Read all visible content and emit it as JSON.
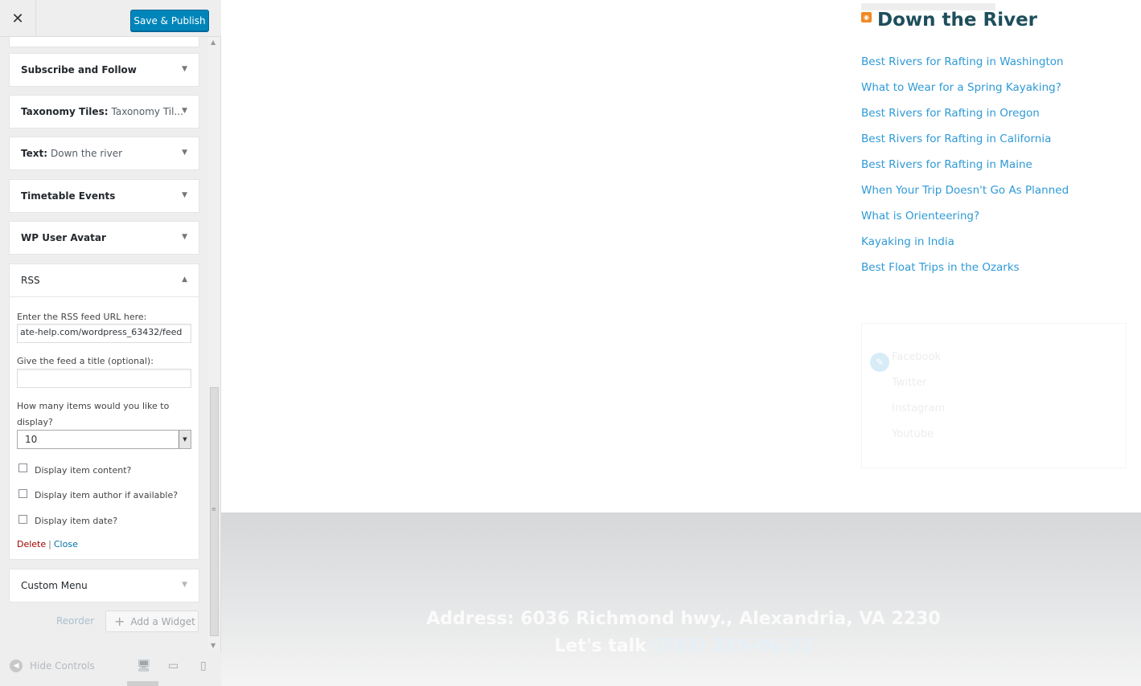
{
  "header": {
    "close_glyph": "✕",
    "publish_label": "Save & Publish"
  },
  "widgets": [
    {
      "title": "Subscribe and Follow",
      "subtitle": ""
    },
    {
      "title": "Taxonomy Tiles:",
      "subtitle": "Taxonomy Til..."
    },
    {
      "title": "Text:",
      "subtitle": "Down the river"
    },
    {
      "title": "Timetable Events",
      "subtitle": ""
    },
    {
      "title": "WP User Avatar",
      "subtitle": ""
    },
    {
      "title": "RSS",
      "subtitle": ""
    },
    {
      "title": "Custom Menu",
      "subtitle": ""
    }
  ],
  "rss_form": {
    "url_label": "Enter the RSS feed URL here:",
    "url_value": "ate-help.com/wordpress_63432/feed",
    "title_label": "Give the feed a title (optional):",
    "title_value": "",
    "count_label": "How many items would you like to display?",
    "count_value": "10",
    "checkboxes": [
      {
        "label": "Display item content?",
        "checked": false
      },
      {
        "label": "Display item author if available?",
        "checked": false
      },
      {
        "label": "Display item date?",
        "checked": false
      }
    ],
    "delete_label": "Delete",
    "separator": "|",
    "close_label": "Close"
  },
  "actions": {
    "reorder_label": "Reorder",
    "add_widget_label": "Add a Widget"
  },
  "bottom_bar": {
    "hide_controls_label": "Hide Controls"
  },
  "preview": {
    "rss_title": "Down the River",
    "rss_items": [
      "Best Rivers for Rafting in Washington",
      "What to Wear for a Spring Kayaking?",
      "Best Rivers for Rafting in Oregon",
      "Best Rivers for Rafting in California",
      "Best Rivers for Rafting in Maine",
      "When Your Trip Doesn't Go As Planned",
      "What is Orienteering?",
      "Kayaking in India",
      "Best Float Trips in the Ozarks"
    ],
    "social_links": [
      "Facebook",
      "Twitter",
      "Instagram",
      "Youtube"
    ],
    "footer_address": "Address: 6036 Richmond hwy., Alexandria, VA 2230",
    "footer_talk_prefix": "Let's talk",
    "footer_phone": "(703) 329-06-32"
  },
  "colors": {
    "accent": "#0085ba",
    "link": "#2f9ad6",
    "title": "#1f4e5c",
    "delete": "#a00000"
  }
}
